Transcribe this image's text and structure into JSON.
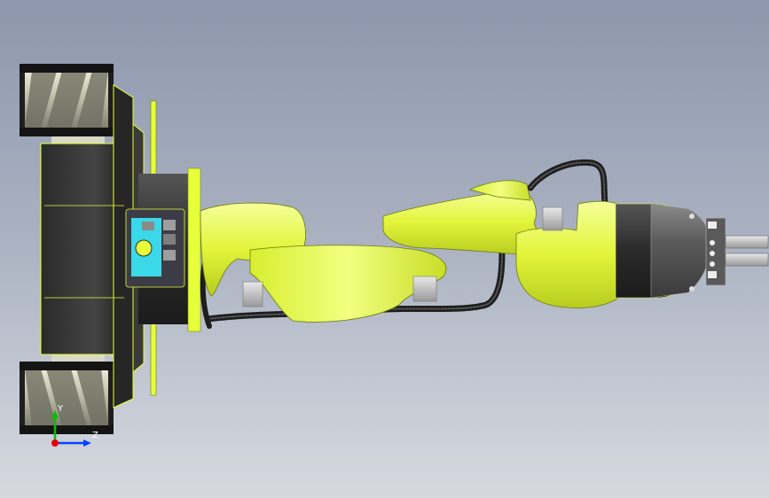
{
  "triad": {
    "y_label": "Y",
    "z_label": "Z",
    "colors": {
      "y": "#00c000",
      "z": "#0044ff",
      "x": "#e00000"
    }
  },
  "scene": {
    "robot_color": "#e6ff3a",
    "dark_color": "#2b2b2b",
    "wheel_color": "#c8c8b0"
  }
}
